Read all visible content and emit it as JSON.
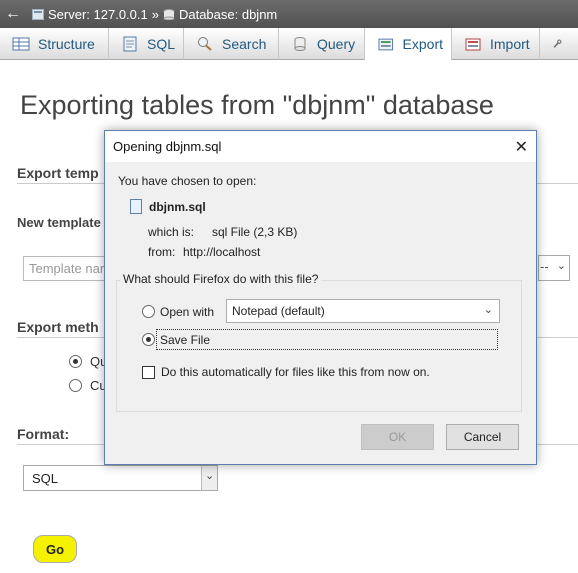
{
  "breadcrumb": {
    "back": "←",
    "server": "Server: 127.0.0.1",
    "separator": "»",
    "database": "Database: dbjnm"
  },
  "tabs": [
    {
      "label": "Structure",
      "icon": "structure-icon"
    },
    {
      "label": "SQL",
      "icon": "sql-icon"
    },
    {
      "label": "Search",
      "icon": "search-icon"
    },
    {
      "label": "Query",
      "icon": "query-icon"
    },
    {
      "label": "Export",
      "icon": "export-icon",
      "active": true
    },
    {
      "label": "Import",
      "icon": "import-icon"
    },
    {
      "label": "",
      "icon": "wrench-icon"
    }
  ],
  "page": {
    "title": "Exporting tables from \"dbjnm\" database",
    "export_templates": "Export temp",
    "new_template": "New template",
    "template_placeholder": "Template nar",
    "export_method": "Export meth",
    "radio_quick": "Qu",
    "radio_custom": "Cu",
    "format_label": "Format:",
    "format_value": "SQL",
    "go": "Go",
    "right_select_text": "--"
  },
  "dialog": {
    "title": "Opening dbjnm.sql",
    "chosen": "You have chosen to open:",
    "filename": "dbjnm.sql",
    "which_is_label": "which is:",
    "which_is_value": "sql File (2,3 KB)",
    "from_label": "from:",
    "from_value": "http://localhost",
    "question": "What should Firefox do with this file?",
    "open_with": "Open with",
    "open_with_app": "Notepad (default)",
    "save_file": "Save File",
    "auto": "Do this automatically for files like this from now on.",
    "ok": "OK",
    "cancel": "Cancel"
  },
  "colors": {
    "topbar": "#5c5c5c",
    "tab_text": "#235a81",
    "go_button": "#f4f200",
    "dialog_border": "#5b7fb0"
  }
}
